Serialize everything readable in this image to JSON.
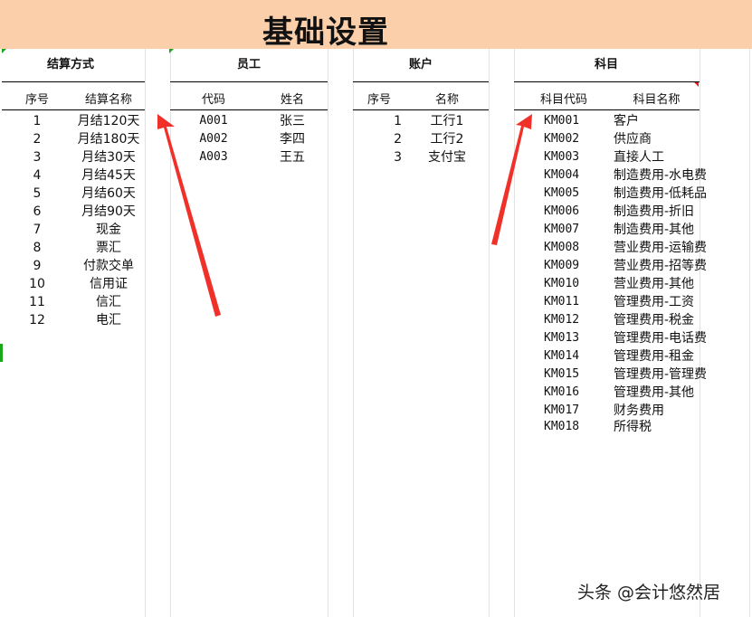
{
  "title": "基础设置",
  "settlement": {
    "title": "结算方式",
    "headers": [
      "序号",
      "结算名称"
    ],
    "rows": [
      [
        "1",
        "月结120天"
      ],
      [
        "2",
        "月结180天"
      ],
      [
        "3",
        "月结30天"
      ],
      [
        "4",
        "月结45天"
      ],
      [
        "5",
        "月结60天"
      ],
      [
        "6",
        "月结90天"
      ],
      [
        "7",
        "现金"
      ],
      [
        "8",
        "票汇"
      ],
      [
        "9",
        "付款交单"
      ],
      [
        "10",
        "信用证"
      ],
      [
        "11",
        "信汇"
      ],
      [
        "12",
        "电汇"
      ]
    ]
  },
  "employee": {
    "title": "员工",
    "headers": [
      "代码",
      "姓名"
    ],
    "rows": [
      [
        "A001",
        "张三"
      ],
      [
        "A002",
        "李四"
      ],
      [
        "A003",
        "王五"
      ]
    ]
  },
  "account": {
    "title": "账户",
    "headers": [
      "序号",
      "名称"
    ],
    "rows": [
      [
        "1",
        "工行1"
      ],
      [
        "2",
        "工行2"
      ],
      [
        "3",
        "支付宝"
      ]
    ]
  },
  "subject": {
    "title": "科目",
    "headers": [
      "科目代码",
      "科目名称"
    ],
    "rows": [
      [
        "KM001",
        "客户"
      ],
      [
        "KM002",
        "供应商"
      ],
      [
        "KM003",
        "直接人工"
      ],
      [
        "KM004",
        "制造费用-水电费"
      ],
      [
        "KM005",
        "制造费用-低耗品"
      ],
      [
        "KM006",
        "制造费用-折旧"
      ],
      [
        "KM007",
        "制造费用-其他"
      ],
      [
        "KM008",
        "营业费用-运输费"
      ],
      [
        "KM009",
        "营业费用-招等费"
      ],
      [
        "KM010",
        "营业费用-其他"
      ],
      [
        "KM011",
        "管理费用-工资"
      ],
      [
        "KM012",
        "管理费用-税金"
      ],
      [
        "KM013",
        "管理费用-电话费"
      ],
      [
        "KM014",
        "管理费用-租金"
      ],
      [
        "KM015",
        "管理费用-管理费"
      ],
      [
        "KM016",
        "管理费用-其他"
      ],
      [
        "KM017",
        "财务费用"
      ],
      [
        "KM018",
        "所得税"
      ]
    ]
  },
  "watermark": "头条 @会计悠然居",
  "colors": {
    "title_band": "#fbcfaa",
    "arrow": "#f0312a"
  }
}
